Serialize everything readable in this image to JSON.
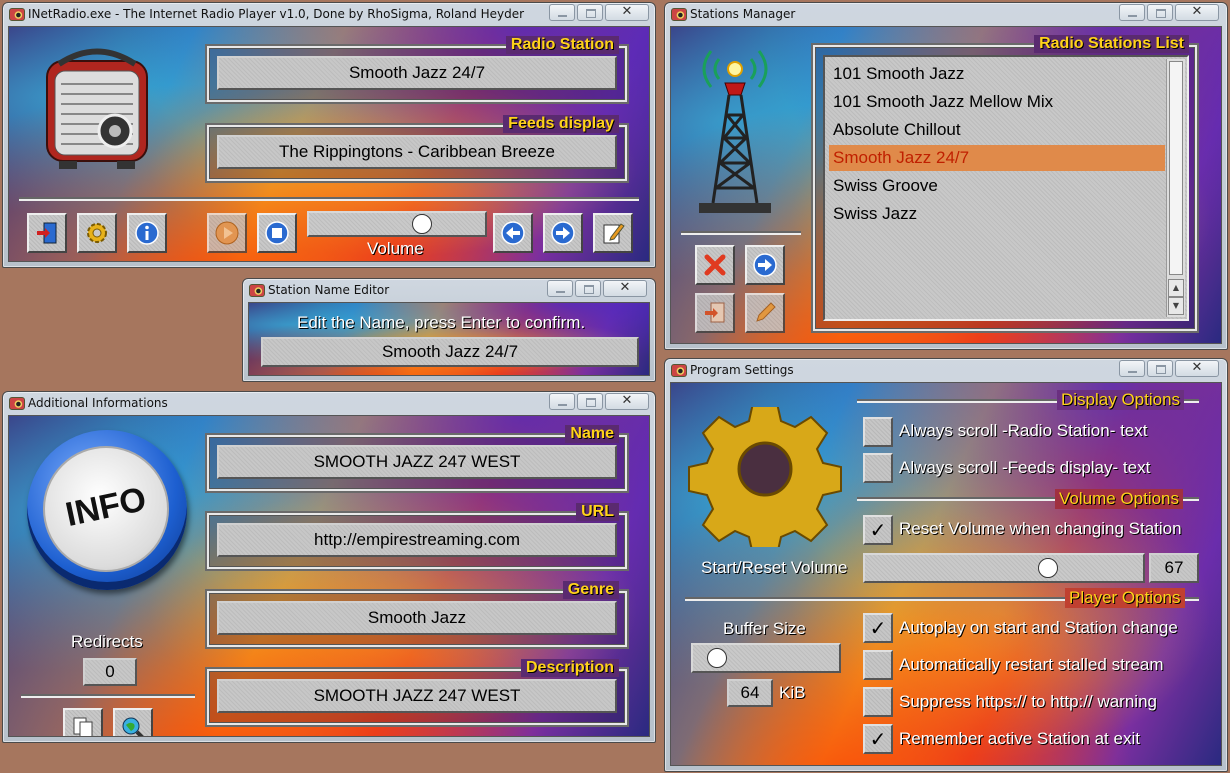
{
  "player": {
    "title": "INetRadio.exe - The Internet Radio Player v1.0, Done by RhoSigma, Roland Heyder",
    "radio_station_label": "Radio Station",
    "radio_station_value": "Smooth Jazz 24/7",
    "feeds_label": "Feeds display",
    "feeds_value": "The Rippingtons - Caribbean Breeze",
    "volume_label": "Volume",
    "volume_level_fraction": 0.66,
    "icons": [
      "exit-icon",
      "settings-gear-icon",
      "info-icon",
      "play-icon",
      "stop-icon",
      "previous-icon",
      "next-icon",
      "edit-note-icon"
    ]
  },
  "stations": {
    "title": "Stations Manager",
    "list_label": "Radio Stations List",
    "items": [
      "101 Smooth Jazz",
      "101 Smooth Jazz Mellow Mix",
      "Absolute Chillout",
      "Smooth Jazz 24/7",
      "Swiss Groove",
      "Swiss Jazz"
    ],
    "selected_index": 3,
    "scroll_up_glyph": "▲",
    "scroll_down_glyph": "▼"
  },
  "editor": {
    "title": "Station Name Editor",
    "prompt": "Edit the Name, press Enter to confirm.",
    "value": "Smooth Jazz 24/7"
  },
  "info": {
    "title": "Additional Informations",
    "logo_text": "INFO",
    "name_label": "Name",
    "name_value": "SMOOTH JAZZ 247 WEST",
    "url_label": "URL",
    "url_value": "http://empirestreaming.com",
    "genre_label": "Genre",
    "genre_value": "Smooth Jazz",
    "description_label": "Description",
    "description_value": "SMOOTH JAZZ 247 WEST",
    "redirects_label": "Redirects",
    "redirects_value": "0"
  },
  "settings": {
    "title": "Program Settings",
    "display_options_label": "Display Options",
    "always_scroll_station": "Always scroll -Radio Station- text",
    "always_scroll_feeds": "Always scroll -Feeds display- text",
    "volume_options_label": "Volume Options",
    "reset_volume": "Reset Volume when changing Station",
    "start_reset_volume_label": "Start/Reset Volume",
    "start_volume_value": "67",
    "player_options_label": "Player Options",
    "buffer_size_label": "Buffer Size",
    "buffer_value": "64",
    "buffer_unit": "KiB",
    "autoplay": "Autoplay on start and Station change",
    "auto_restart": "Automatically restart stalled stream",
    "suppress_https": "Suppress https:// to http:// warning",
    "remember_station": "Remember active Station at exit",
    "checks": {
      "always_scroll_station": false,
      "always_scroll_feeds": false,
      "reset_volume": true,
      "autoplay": true,
      "auto_restart": false,
      "suppress_https": false,
      "remember_station": true
    },
    "check_glyph": "✓",
    "close_glyph": "✕"
  }
}
